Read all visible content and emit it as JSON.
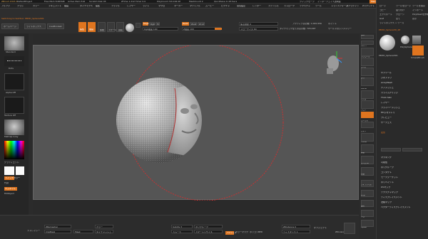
{
  "titlebar": {
    "app": "ZBrush 2023.2",
    "project": "DefaultProject",
    "mem1": "Free Mem 8.663GB",
    "mem2": "Active Mem 516",
    "scratch": "Scratch Disk 45",
    "timer": "ZTime 1.212 Timer 0.0",
    "polycount": "PolyCount 720.164 KP",
    "meshcount": "MeshCount 2",
    "quicksave": "QuickSave In 26 Secs",
    "quicksave_label": "クイックセーブ",
    "interface_label": "インターフェイス透明度",
    "menu_btn": "Menu",
    "script": "DefaultZScript"
  },
  "menubar": {
    "items": [
      "アルファ",
      "ブラシ",
      "カラー",
      "ドキュメント",
      "描画",
      "ダイナミクス",
      "編集",
      "ファイル",
      "レイヤー",
      "ライト",
      "マクロ",
      "マーカー",
      "マテリアル",
      "ムービー",
      "ピクチャ",
      "環境設定",
      "レンダー",
      "ステンシル",
      "ストローク",
      "テクスチャ",
      "ツール",
      "トランスフォーム",
      "Zプラグイン",
      "Zスクリプト",
      "ヘルプ"
    ]
  },
  "subbar": {
    "notice": "Switching to SubTool: PM3D_Sphere3D1",
    "home_tab": "ホームページ",
    "lightbox_tab": "ライトボックス",
    "liveboolean_tab": "LiveBoolean",
    "edit_label": "編集",
    "draw_label": "描画",
    "move_label": "移動",
    "scale_label": "スケール",
    "rotate_label": "回転",
    "mrgb": "Mrgb",
    "rgb": "Rgb",
    "m": "M",
    "zadd": "Zadd",
    "zsub": "Zsub",
    "zcut": "Zcut",
    "rgb_intensity": "Rgb強度 100",
    "z_intensity": "Z強度 100",
    "focal_shift": "焦点調節 0",
    "draw_size": "ドローサイズ 64",
    "dynamic": "ダイナミック",
    "active_points": "アクティブ点の数: 1,000,956",
    "total_points": "全ての点の数: 720,448",
    "ws_mirror": "ワールドのシンメトリー",
    "points_label": "ポイント"
  },
  "leftpanel": {
    "brush_label": "Standard",
    "stroke_label": "Dots",
    "alpha_label": "Alpha Off",
    "texture_label": "Texture Off",
    "material_label": "MatCap Gray",
    "gradient_label": "グラディエント",
    "switch_color": "スイッチカラー",
    "alternate": "代替",
    "mask_label": "サムネイル",
    "fill_label": "FillObject",
    "dock_label": "トップ",
    "bottom1": "左右交換",
    "bottom2": "右への切替"
  },
  "canvas": {
    "navcube_label": "Y"
  },
  "rightstrip": {
    "items": [
      "BPR",
      "SPix 3",
      "スクロール",
      "ズーム",
      "実寸",
      "AAHalf",
      "パース",
      "フロア",
      "ローカル",
      "ガイド",
      "Frame",
      "移動",
      "ズーム3D",
      "回転",
      "ラインフィル",
      "PolyF",
      "透明",
      "ソロ",
      "Xpose"
    ]
  },
  "rightpanel": {
    "header_items": [
      "ロード",
      "ツールをロード",
      "ツールを保存",
      "コピー",
      "貼り付け",
      "インポート",
      "エクスポート",
      "クローン",
      "PolyMeshを作成",
      "GoZ",
      "全て",
      "表示",
      "ライトボックス > ツール"
    ],
    "tool_name": "PM3D_Sphere3D_48",
    "thumb_labels": [
      "PM3D_Sphere3D1",
      "PolySphere",
      "Cylinder3D",
      "SimpleBrush"
    ],
    "subtool_header": "サブツール",
    "items": [
      "ジオメトリ",
      "ArrayMesh",
      "ナノメッシュ",
      "スライムブリッジ",
      "Thick Skin",
      "レイヤー",
      "ファイバーメッシュ",
      "HDジオメトリ",
      "プレビュー",
      "サーフェス",
      "ノーマル",
      "ポリグループ",
      "マスキング",
      "シャドウボックス",
      "モーファーゲット",
      "ポリペイント",
      "UVマップ",
      "テクスチャマップ",
      "ディスプレイスメント",
      "法線マップ",
      "ベクターディスプレイスメント",
      "統一化スケール",
      "表示プロパティ",
      "ユニファイドスキン",
      "初期化",
      "インポート",
      "エクスポート"
    ],
    "subtool_items": [
      "変形",
      "マスキング",
      "可視性",
      "ポリグループ",
      "コンタクト",
      "モーファーゲット",
      "ポリペイント",
      "UVマップ",
      "テクスチャマップ",
      "ディスプレイスメント",
      "法線マップ",
      "ベクターディスプレイスメント"
    ]
  },
  "bottombar": {
    "f1": "ストレイシー",
    "f2": "ZRemesher",
    "f3": "ClipMask",
    "f4": "Mask",
    "f5": "カラー",
    "f6": "ダイナメッシュ",
    "f7": "Subdiv 3",
    "f8": "スムース",
    "f9": "ポリグループ",
    "f10": "スマートリサイズ",
    "f11": "アクティブ",
    "f12": "カラーマスク",
    "f13": "ポリゴンBPR",
    "f14": "ZDivision",
    "v1": "ZDistance 0",
    "v2": "オブジェクト",
    "v3": "ディスタンス 1"
  },
  "colors": {
    "accent": "#e0751f",
    "canvas_bg": "#555555",
    "panel_bg": "#2a2a2a",
    "brush_ring": "#c83232"
  }
}
